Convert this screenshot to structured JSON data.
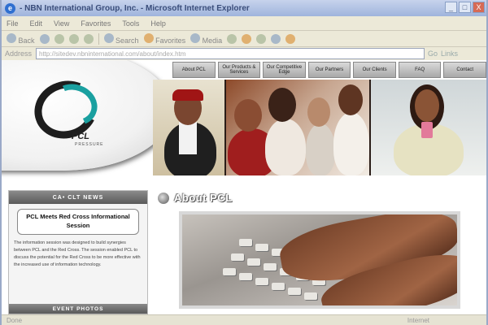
{
  "window": {
    "title": "- NBN International Group, Inc. - Microsoft Internet Explorer",
    "controls": [
      "_",
      "□",
      "X"
    ]
  },
  "menubar": [
    "File",
    "Edit",
    "View",
    "Favorites",
    "Tools",
    "Help"
  ],
  "toolbar": {
    "back": "Back",
    "search": "Search",
    "favorites": "Favorites",
    "media": "Media"
  },
  "address": {
    "label": "Address",
    "url": "http://sitedev.nbninternational.com/about/index.htm",
    "go": "Go",
    "links": "Links"
  },
  "site": {
    "logo_text": "PCL",
    "logo_sub": "PRESSURE",
    "nav": [
      "About PCL",
      "Our Products & Services",
      "Our Competitive Edge",
      "Our Partners",
      "Our Clients",
      "FAQ",
      "Contact"
    ],
    "left_col": {
      "heading": "CA• CLT NEWS",
      "news_title": "PCL Meets Red Cross Informational Session",
      "news_body": "The information session was designed to build synergies between PCL and the Red Cross. The session enabled PCL to discuss the potential for the Red Cross to be more effective with the increased use of information technology.",
      "footer": "EVENT PHOTOS"
    },
    "about_title": "About PCL"
  },
  "status": {
    "left": "Done",
    "right": "Internet"
  }
}
